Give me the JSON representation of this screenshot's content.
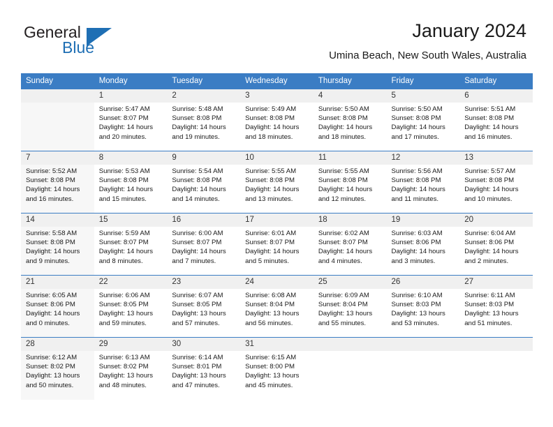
{
  "brand": {
    "name_part1": "General",
    "name_part2": "Blue",
    "flag_icon": "triangle-flag-icon"
  },
  "header": {
    "title": "January 2024",
    "subtitle": "Umina Beach, New South Wales, Australia"
  },
  "calendar": {
    "weekday_headers": [
      "Sunday",
      "Monday",
      "Tuesday",
      "Wednesday",
      "Thursday",
      "Friday",
      "Saturday"
    ],
    "accent_color": "#3b7dc4",
    "weeks": [
      [
        {
          "day": "",
          "lines": []
        },
        {
          "day": "1",
          "lines": [
            "Sunrise: 5:47 AM",
            "Sunset: 8:07 PM",
            "Daylight: 14 hours",
            "and 20 minutes."
          ]
        },
        {
          "day": "2",
          "lines": [
            "Sunrise: 5:48 AM",
            "Sunset: 8:08 PM",
            "Daylight: 14 hours",
            "and 19 minutes."
          ]
        },
        {
          "day": "3",
          "lines": [
            "Sunrise: 5:49 AM",
            "Sunset: 8:08 PM",
            "Daylight: 14 hours",
            "and 18 minutes."
          ]
        },
        {
          "day": "4",
          "lines": [
            "Sunrise: 5:50 AM",
            "Sunset: 8:08 PM",
            "Daylight: 14 hours",
            "and 18 minutes."
          ]
        },
        {
          "day": "5",
          "lines": [
            "Sunrise: 5:50 AM",
            "Sunset: 8:08 PM",
            "Daylight: 14 hours",
            "and 17 minutes."
          ]
        },
        {
          "day": "6",
          "lines": [
            "Sunrise: 5:51 AM",
            "Sunset: 8:08 PM",
            "Daylight: 14 hours",
            "and 16 minutes."
          ]
        }
      ],
      [
        {
          "day": "7",
          "lines": [
            "Sunrise: 5:52 AM",
            "Sunset: 8:08 PM",
            "Daylight: 14 hours",
            "and 16 minutes."
          ]
        },
        {
          "day": "8",
          "lines": [
            "Sunrise: 5:53 AM",
            "Sunset: 8:08 PM",
            "Daylight: 14 hours",
            "and 15 minutes."
          ]
        },
        {
          "day": "9",
          "lines": [
            "Sunrise: 5:54 AM",
            "Sunset: 8:08 PM",
            "Daylight: 14 hours",
            "and 14 minutes."
          ]
        },
        {
          "day": "10",
          "lines": [
            "Sunrise: 5:55 AM",
            "Sunset: 8:08 PM",
            "Daylight: 14 hours",
            "and 13 minutes."
          ]
        },
        {
          "day": "11",
          "lines": [
            "Sunrise: 5:55 AM",
            "Sunset: 8:08 PM",
            "Daylight: 14 hours",
            "and 12 minutes."
          ]
        },
        {
          "day": "12",
          "lines": [
            "Sunrise: 5:56 AM",
            "Sunset: 8:08 PM",
            "Daylight: 14 hours",
            "and 11 minutes."
          ]
        },
        {
          "day": "13",
          "lines": [
            "Sunrise: 5:57 AM",
            "Sunset: 8:08 PM",
            "Daylight: 14 hours",
            "and 10 minutes."
          ]
        }
      ],
      [
        {
          "day": "14",
          "lines": [
            "Sunrise: 5:58 AM",
            "Sunset: 8:08 PM",
            "Daylight: 14 hours",
            "and 9 minutes."
          ]
        },
        {
          "day": "15",
          "lines": [
            "Sunrise: 5:59 AM",
            "Sunset: 8:07 PM",
            "Daylight: 14 hours",
            "and 8 minutes."
          ]
        },
        {
          "day": "16",
          "lines": [
            "Sunrise: 6:00 AM",
            "Sunset: 8:07 PM",
            "Daylight: 14 hours",
            "and 7 minutes."
          ]
        },
        {
          "day": "17",
          "lines": [
            "Sunrise: 6:01 AM",
            "Sunset: 8:07 PM",
            "Daylight: 14 hours",
            "and 5 minutes."
          ]
        },
        {
          "day": "18",
          "lines": [
            "Sunrise: 6:02 AM",
            "Sunset: 8:07 PM",
            "Daylight: 14 hours",
            "and 4 minutes."
          ]
        },
        {
          "day": "19",
          "lines": [
            "Sunrise: 6:03 AM",
            "Sunset: 8:06 PM",
            "Daylight: 14 hours",
            "and 3 minutes."
          ]
        },
        {
          "day": "20",
          "lines": [
            "Sunrise: 6:04 AM",
            "Sunset: 8:06 PM",
            "Daylight: 14 hours",
            "and 2 minutes."
          ]
        }
      ],
      [
        {
          "day": "21",
          "lines": [
            "Sunrise: 6:05 AM",
            "Sunset: 8:06 PM",
            "Daylight: 14 hours",
            "and 0 minutes."
          ]
        },
        {
          "day": "22",
          "lines": [
            "Sunrise: 6:06 AM",
            "Sunset: 8:05 PM",
            "Daylight: 13 hours",
            "and 59 minutes."
          ]
        },
        {
          "day": "23",
          "lines": [
            "Sunrise: 6:07 AM",
            "Sunset: 8:05 PM",
            "Daylight: 13 hours",
            "and 57 minutes."
          ]
        },
        {
          "day": "24",
          "lines": [
            "Sunrise: 6:08 AM",
            "Sunset: 8:04 PM",
            "Daylight: 13 hours",
            "and 56 minutes."
          ]
        },
        {
          "day": "25",
          "lines": [
            "Sunrise: 6:09 AM",
            "Sunset: 8:04 PM",
            "Daylight: 13 hours",
            "and 55 minutes."
          ]
        },
        {
          "day": "26",
          "lines": [
            "Sunrise: 6:10 AM",
            "Sunset: 8:03 PM",
            "Daylight: 13 hours",
            "and 53 minutes."
          ]
        },
        {
          "day": "27",
          "lines": [
            "Sunrise: 6:11 AM",
            "Sunset: 8:03 PM",
            "Daylight: 13 hours",
            "and 51 minutes."
          ]
        }
      ],
      [
        {
          "day": "28",
          "lines": [
            "Sunrise: 6:12 AM",
            "Sunset: 8:02 PM",
            "Daylight: 13 hours",
            "and 50 minutes."
          ]
        },
        {
          "day": "29",
          "lines": [
            "Sunrise: 6:13 AM",
            "Sunset: 8:02 PM",
            "Daylight: 13 hours",
            "and 48 minutes."
          ]
        },
        {
          "day": "30",
          "lines": [
            "Sunrise: 6:14 AM",
            "Sunset: 8:01 PM",
            "Daylight: 13 hours",
            "and 47 minutes."
          ]
        },
        {
          "day": "31",
          "lines": [
            "Sunrise: 6:15 AM",
            "Sunset: 8:00 PM",
            "Daylight: 13 hours",
            "and 45 minutes."
          ]
        },
        {
          "day": "",
          "lines": []
        },
        {
          "day": "",
          "lines": []
        },
        {
          "day": "",
          "lines": []
        }
      ]
    ]
  }
}
